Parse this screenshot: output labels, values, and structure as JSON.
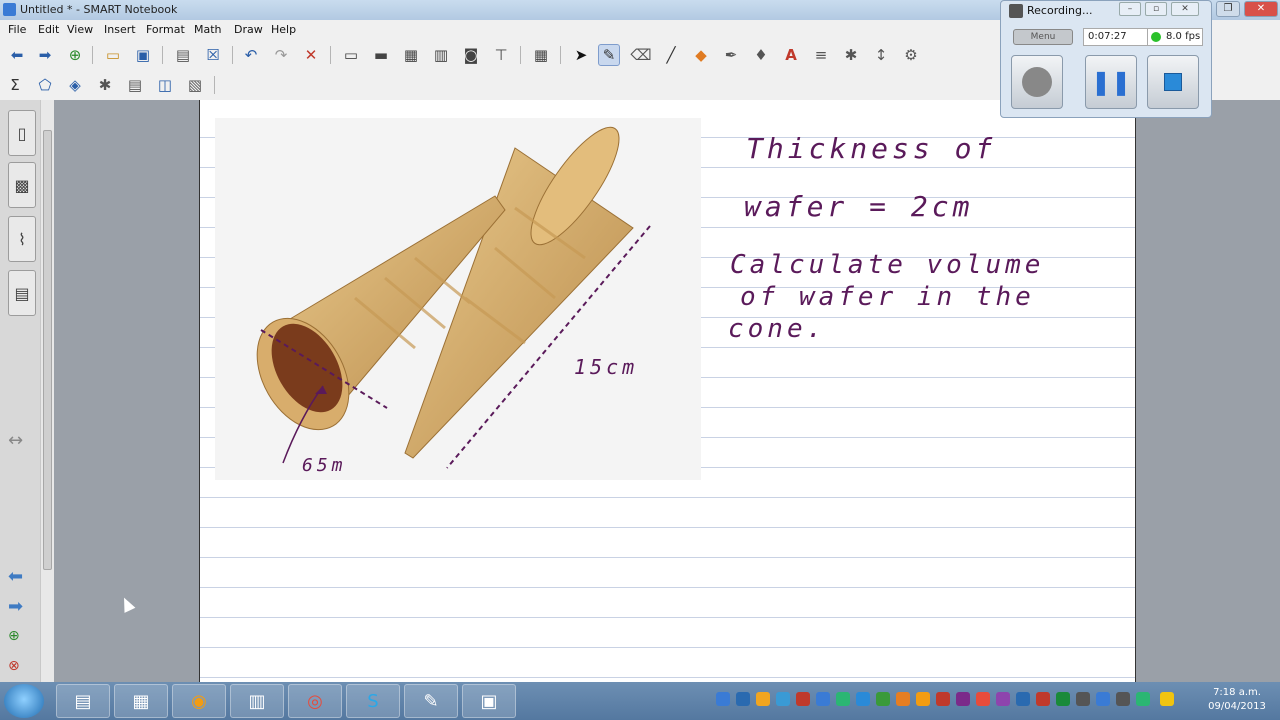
{
  "window": {
    "title": "Untitled * - SMART Notebook"
  },
  "menu": [
    "File",
    "Edit",
    "View",
    "Insert",
    "Format",
    "Math",
    "Draw",
    "Help"
  ],
  "recorder": {
    "title": "Recording...",
    "menu_label": "Menu",
    "elapsed": "0:07:27",
    "fps": "8.0 fps"
  },
  "notes": {
    "line1": "Thickness of",
    "line2": "wafer = 2cm",
    "line3": "Calculate volume",
    "line4": "of wafer in the",
    "line5": "cone.",
    "label_slant": "15cm",
    "label_diam": "65m"
  },
  "taskbar": {
    "time": "7:18 a.m.",
    "date": "09/04/2013"
  },
  "colors": {
    "ink": "#5a1a5a",
    "ruled_line": "#c9d2e4",
    "accent_blue": "#2a5ea8"
  }
}
